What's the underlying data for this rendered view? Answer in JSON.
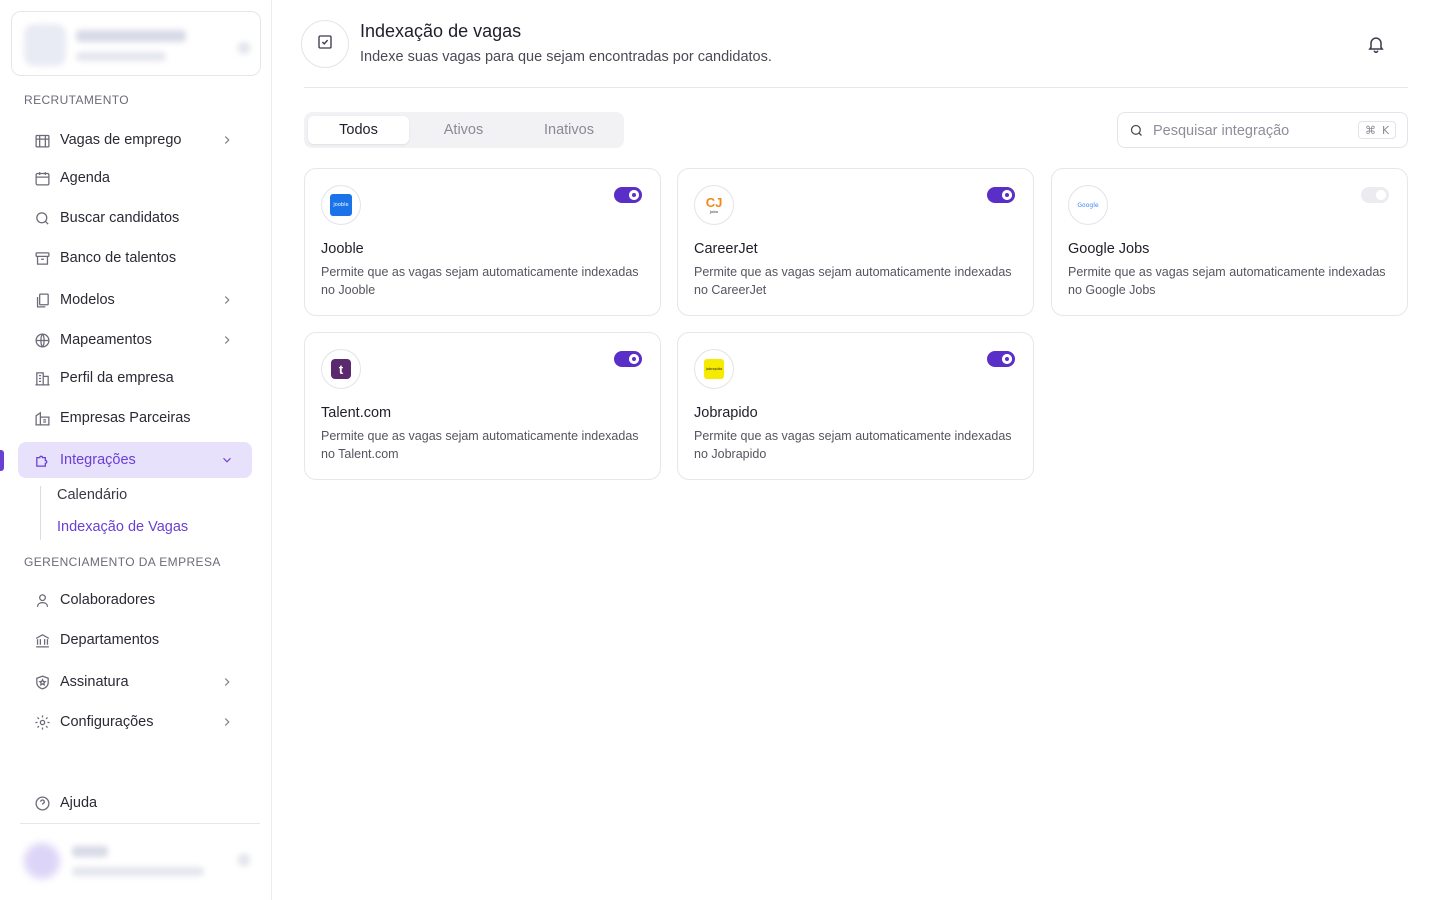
{
  "sidebar": {
    "sections": {
      "recruitment": "RECRUTAMENTO",
      "company": "GERENCIAMENTO DA EMPRESA"
    },
    "items": {
      "vagas": "Vagas de emprego",
      "agenda": "Agenda",
      "buscar": "Buscar candidatos",
      "banco": "Banco de talentos",
      "modelos": "Modelos",
      "mapeamentos": "Mapeamentos",
      "perfil": "Perfil da empresa",
      "parceiras": "Empresas Parceiras",
      "integracoes": "Integrações",
      "calendario": "Calendário",
      "indexacao": "Indexação de Vagas",
      "colaboradores": "Colaboradores",
      "departamentos": "Departamentos",
      "assinatura": "Assinatura",
      "configuracoes": "Configurações",
      "ajuda": "Ajuda"
    },
    "accent_color": "#6a3fd4"
  },
  "header": {
    "title": "Indexação de vagas",
    "subtitle": "Indexe suas vagas para que sejam encontradas por candidatos."
  },
  "tabs": [
    "Todos",
    "Ativos",
    "Inativos"
  ],
  "selected_tab": "Todos",
  "search": {
    "placeholder": "Pesquisar integração",
    "shortcut_symbol": "⌘",
    "shortcut_key": "K"
  },
  "integrations": [
    {
      "name": "Jooble",
      "description": "Permite que as vagas sejam automaticamente indexadas no Jooble",
      "enabled": true,
      "logo_text": "jooble"
    },
    {
      "name": "CareerJet",
      "description": "Permite que as vagas sejam automaticamente indexadas no CareerJet",
      "enabled": true,
      "logo_text": "CJ"
    },
    {
      "name": "Google Jobs",
      "description": "Permite que as vagas sejam automaticamente indexadas no Google Jobs",
      "enabled": false,
      "logo_text": "Google"
    },
    {
      "name": "Talent.com",
      "description": "Permite que as vagas sejam automaticamente indexadas no Talent.com",
      "enabled": true,
      "logo_text": "t"
    },
    {
      "name": "Jobrapido",
      "description": "Permite que as vagas sejam automaticamente indexadas no Jobrapido",
      "enabled": true,
      "logo_text": "jobrapido"
    }
  ],
  "toggle_on_color": "#5a2fc8"
}
